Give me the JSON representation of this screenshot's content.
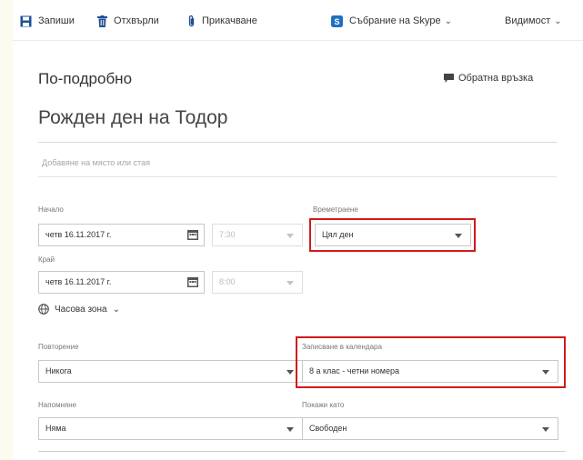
{
  "toolbar": {
    "save_label": "Запиши",
    "discard_label": "Отхвърли",
    "attach_label": "Прикачване",
    "skype_label": "Събрание на Skype",
    "visibility_label": "Видимост"
  },
  "header": {
    "section_title": "По-подробно",
    "feedback_label": "Обратна връзка"
  },
  "event": {
    "title": "Рожден ден на Тодор",
    "location_placeholder": "Добавяне на място или стая"
  },
  "start": {
    "label": "Начало",
    "date": "четв 16.11.2017 г.",
    "time": "7:30"
  },
  "end": {
    "label": "Край",
    "date": "четв 16.11.2017 г.",
    "time": "8:00"
  },
  "duration": {
    "label": "Времетраене",
    "value": "Цял ден"
  },
  "timezone": {
    "label": "Часова зона"
  },
  "repeat": {
    "label": "Повторение",
    "value": "Никога"
  },
  "calendar": {
    "label": "Записване в календара",
    "value": "8 а клас - четни номера"
  },
  "reminder": {
    "label": "Напомняне",
    "value": "Няма"
  },
  "show_as": {
    "label": "Покажи като",
    "value": "Свободен"
  },
  "colors": {
    "accent": "#1f4e96",
    "highlight": "#d11a1a",
    "skype": "#1f6fc0"
  }
}
